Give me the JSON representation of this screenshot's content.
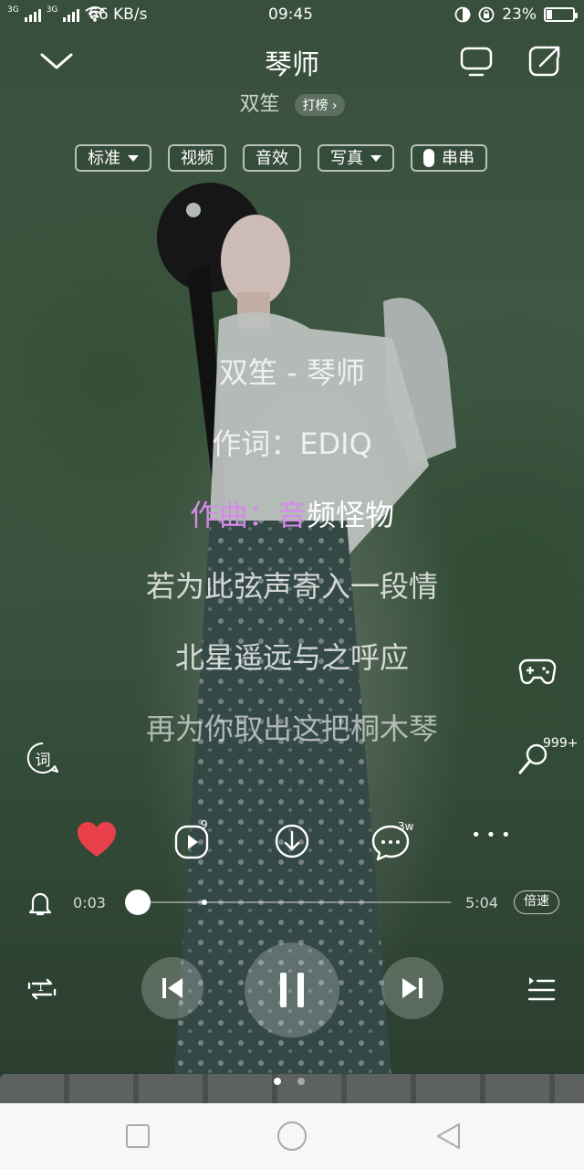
{
  "status_bar": {
    "network_1": "3G",
    "network_2": "3G",
    "speed": "66 KB/s",
    "time": "09:45",
    "battery": "23%",
    "battery_level": 0.23
  },
  "header": {
    "title": "琴师",
    "artist": "双笙",
    "chart_button": "打榜"
  },
  "options": {
    "quality": "标准",
    "video": "视频",
    "effects": "音效",
    "photo": "写真",
    "chain": "串串"
  },
  "lyrics": {
    "line1": "双笙 - 琴师",
    "line2": "作词：EDIQ",
    "line3_sung": "作曲：音",
    "line3_rest": "频怪物",
    "line4": "若为此弦声寄入一段情",
    "line5": "北星遥远与之呼应",
    "line6": "再为你取出这把桐木琴"
  },
  "side": {
    "lyrics_icon_label": "词",
    "karaoke_count": "999+"
  },
  "actions": {
    "mv_count": "9",
    "comment_count": "3w",
    "more": "• • •"
  },
  "progress": {
    "current": "0:03",
    "total": "5:04",
    "speed_button": "倍速",
    "played_fraction": 0.01
  },
  "playback": {
    "repeat_badge": "1"
  },
  "colors": {
    "accent_lyric": "#d58ae8",
    "heart": "#e8404a"
  },
  "icons": [
    "chevron-down-icon",
    "screen-icon",
    "share-icon",
    "lyrics-icon",
    "gamepad-icon",
    "microphone-icon",
    "heart-icon",
    "mv-icon",
    "download-icon",
    "comment-icon",
    "more-icon",
    "bell-icon",
    "repeat-one-icon",
    "previous-icon",
    "pause-icon",
    "next-icon",
    "playlist-icon",
    "nav-square-icon",
    "nav-circle-icon",
    "nav-back-icon"
  ]
}
